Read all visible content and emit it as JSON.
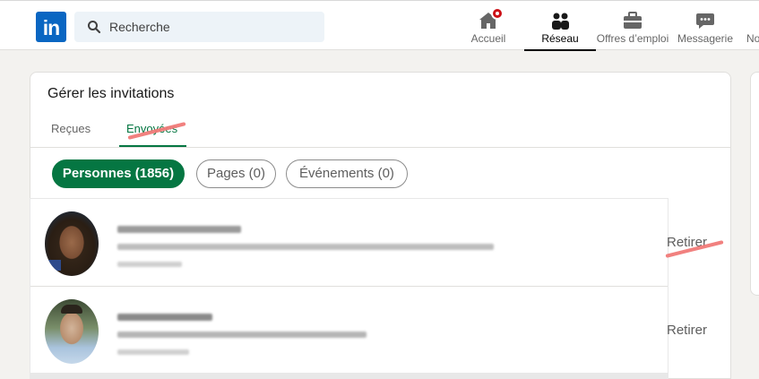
{
  "search": {
    "placeholder": "Recherche"
  },
  "nav": [
    {
      "label": "Accueil",
      "icon": "home-icon"
    },
    {
      "label": "Réseau",
      "icon": "network-icon",
      "active": true
    },
    {
      "label": "Offres d’emploi",
      "icon": "briefcase-icon"
    },
    {
      "label": "Messagerie",
      "icon": "messaging-icon"
    },
    {
      "label": "No",
      "icon": "notifications-icon"
    }
  ],
  "logo_text": "in",
  "invitations": {
    "title": "Gérer les invitations",
    "tabs": [
      {
        "label": "Reçues"
      },
      {
        "label": "Envoyées",
        "active": true
      }
    ],
    "filters": [
      {
        "label": "Personnes (1856)",
        "active": true
      },
      {
        "label": "Pages (0)"
      },
      {
        "label": "Événements (0)"
      }
    ],
    "rows": [
      {
        "action": "Retirer"
      },
      {
        "action": "Retirer"
      }
    ]
  },
  "colors": {
    "brand": "#0a66c2",
    "accent_green": "#057642",
    "notification_red": "#cc1016",
    "annotation_red": "#f07a78"
  }
}
